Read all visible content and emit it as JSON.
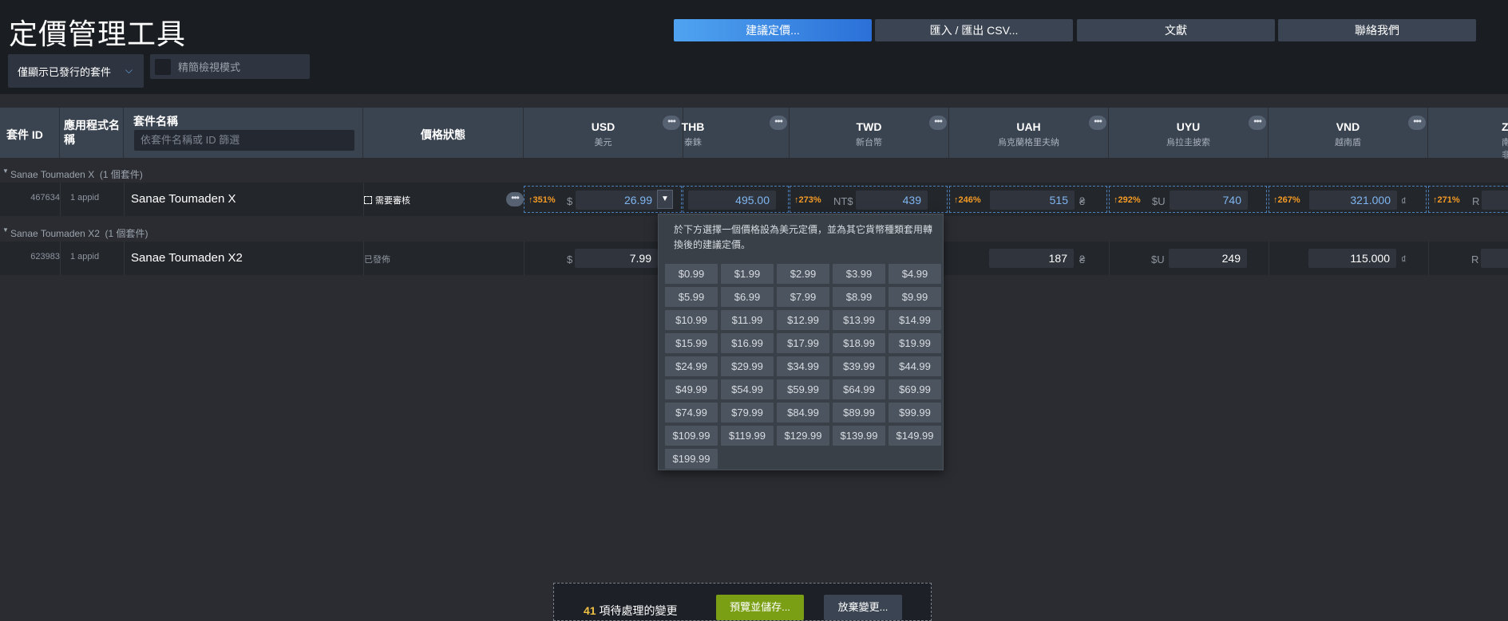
{
  "title": "定價管理工具",
  "top_buttons": [
    "建議定價...",
    "匯入 / 匯出 CSV...",
    "文獻",
    "聯絡我們"
  ],
  "filter": {
    "selected": "僅顯示已發行的套件"
  },
  "compact_mode": {
    "label": "精簡檢視模式"
  },
  "columns": {
    "package_id": "套件 ID",
    "app_name": "應用程式名稱",
    "package_name": "套件名稱",
    "search_placeholder": "依套件名稱或 ID 篩選",
    "price_status": "價格狀態"
  },
  "currencies": [
    {
      "code": "USD",
      "name": "美元"
    },
    {
      "code": "THB",
      "name": "泰銖"
    },
    {
      "code": "TWD",
      "name": "新台幣"
    },
    {
      "code": "UAH",
      "name": "烏克蘭格里夫納"
    },
    {
      "code": "UYU",
      "name": "烏拉圭披索"
    },
    {
      "code": "VND",
      "name": "越南盾"
    },
    {
      "code": "ZA",
      "name": "南非"
    }
  ],
  "groups": [
    {
      "name": "Sanae Toumaden X",
      "count": "(1 個套件)",
      "row": {
        "id": "467634",
        "appid": "1 appid",
        "name": "Sanae Toumaden X",
        "status": "需要審核",
        "usd": {
          "pct": "351%",
          "sym": "$",
          "value": "26.99"
        },
        "thb": {
          "value": "495.00"
        },
        "twd": {
          "pct": "273%",
          "sym": "NT$",
          "value": "439"
        },
        "uah": {
          "pct": "246%",
          "value": "515",
          "sym": "₴"
        },
        "uyu": {
          "pct": "292%",
          "sym": "$U",
          "value": "740"
        },
        "vnd": {
          "pct": "267%",
          "value": "321.000",
          "sym": "₫"
        },
        "zar": {
          "pct": "271%",
          "sym": "R"
        }
      }
    },
    {
      "name": "Sanae Toumaden X2",
      "count": "(1 個套件)",
      "row": {
        "id": "623983",
        "appid": "1 appid",
        "name": "Sanae Toumaden X2",
        "status": "已發佈",
        "usd": {
          "sym": "$",
          "value": "7.99"
        },
        "uah": {
          "value": "187",
          "sym": "₴"
        },
        "uyu": {
          "sym": "$U",
          "value": "249"
        },
        "vnd": {
          "value": "115.000",
          "sym": "₫"
        },
        "zar": {
          "sym": "R"
        }
      }
    }
  ],
  "price_popup": {
    "description": "於下方選擇一個價格設為美元定價，並為其它貨幣種類套用轉換後的建議定價。",
    "prices": [
      "$0.99",
      "$1.99",
      "$2.99",
      "$3.99",
      "$4.99",
      "$5.99",
      "$6.99",
      "$7.99",
      "$8.99",
      "$9.99",
      "$10.99",
      "$11.99",
      "$12.99",
      "$13.99",
      "$14.99",
      "$15.99",
      "$16.99",
      "$17.99",
      "$18.99",
      "$19.99",
      "$24.99",
      "$29.99",
      "$34.99",
      "$39.99",
      "$44.99",
      "$49.99",
      "$54.99",
      "$59.99",
      "$64.99",
      "$69.99",
      "$74.99",
      "$79.99",
      "$84.99",
      "$89.99",
      "$99.99",
      "$109.99",
      "$119.99",
      "$129.99",
      "$139.99",
      "$149.99",
      "$199.99"
    ]
  },
  "bottom_bar": {
    "pending_count": "41",
    "pending_text": "項待處理的變更",
    "save_label": "預覽並儲存...",
    "discard_label": "放棄變更..."
  },
  "colors": {
    "accent": "#2b70d8",
    "warning": "#f59b24",
    "save": "#7a9f14"
  }
}
